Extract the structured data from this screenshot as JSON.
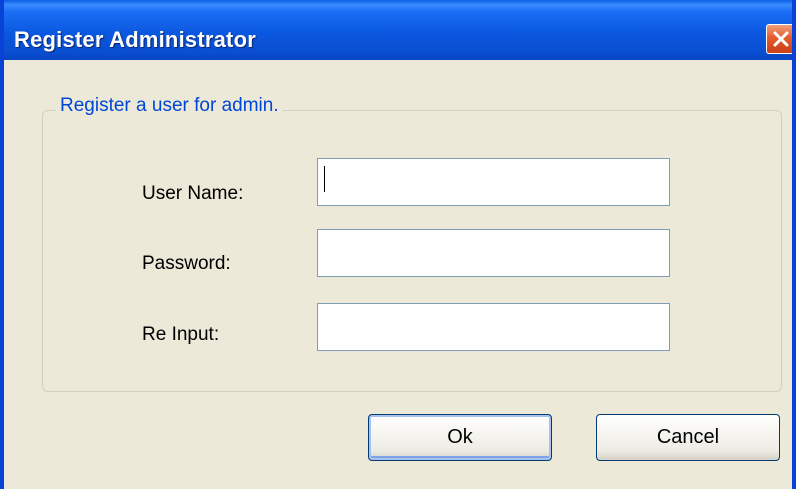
{
  "window": {
    "title": "Register Administrator",
    "close_icon": "close-x-icon"
  },
  "group": {
    "legend": "Register  a user for admin."
  },
  "fields": {
    "username": {
      "label": "User Name:",
      "value": "",
      "placeholder": ""
    },
    "password": {
      "label": "Password:",
      "value": "",
      "placeholder": ""
    },
    "reinput": {
      "label": "Re Input:",
      "value": "",
      "placeholder": ""
    }
  },
  "buttons": {
    "ok": "Ok",
    "cancel": "Cancel"
  },
  "colors": {
    "titlebar": "#0a56e0",
    "close_button": "#e35d2e",
    "legend_text": "#0046d5",
    "window_face": "#ece9d8",
    "input_border": "#7f9db9"
  }
}
